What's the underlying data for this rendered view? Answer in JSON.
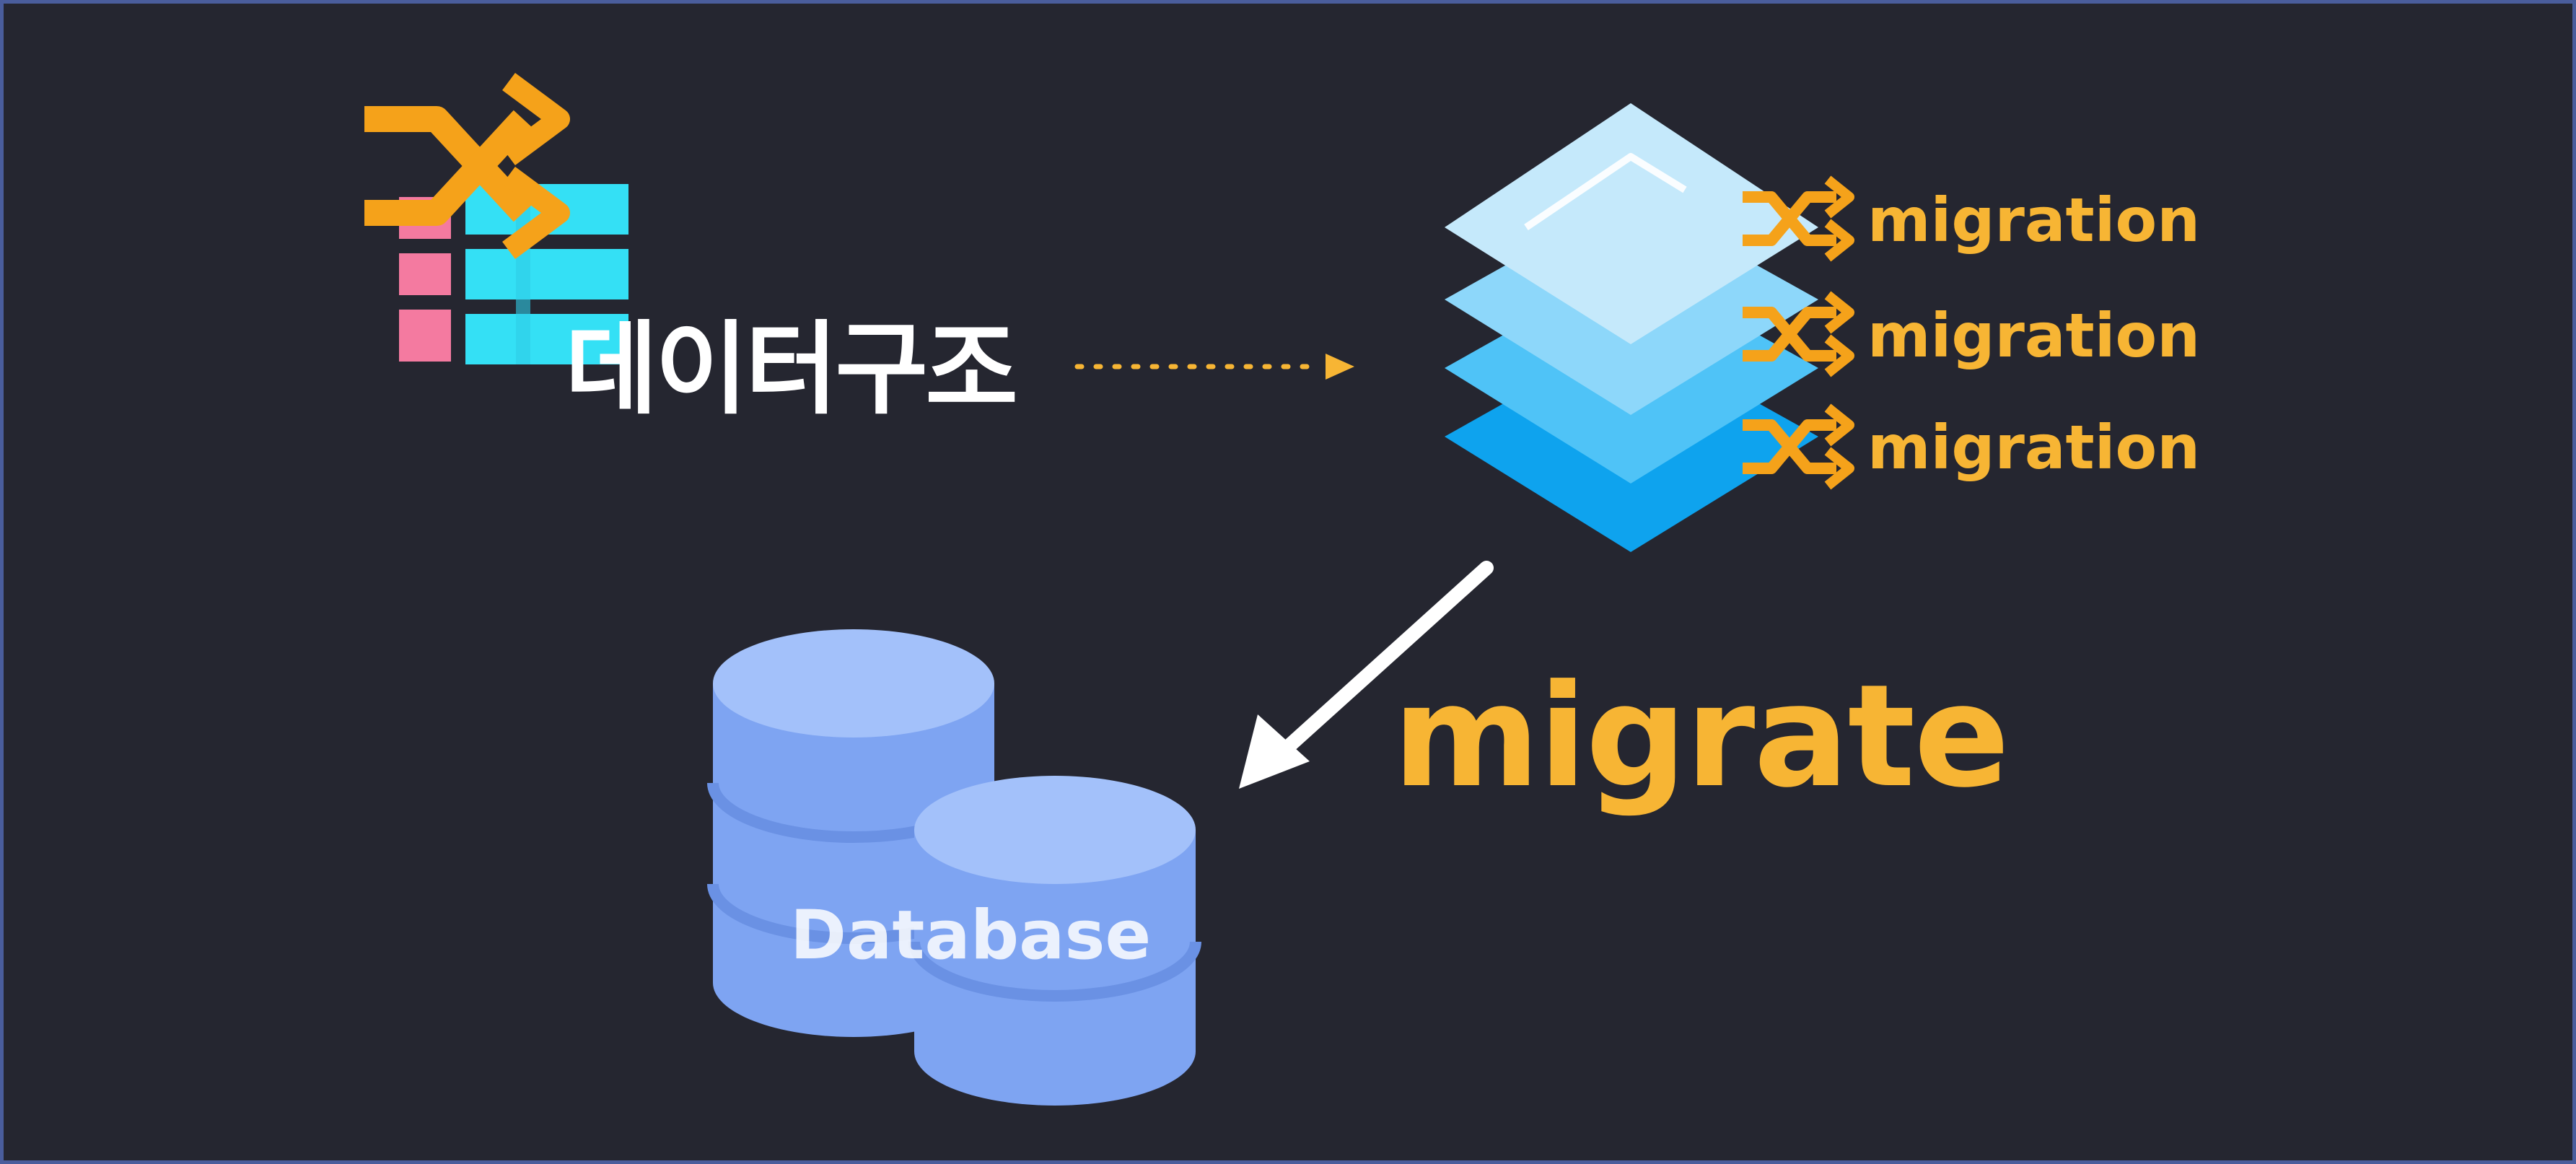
{
  "diagram": {
    "data_structure_label": "데이터구조",
    "migration_labels": [
      "migration",
      "migration",
      "migration"
    ],
    "migrate_label": "migrate",
    "database_label": "Database"
  },
  "colors": {
    "background": "#252630",
    "border": "#4a5d9c",
    "accent_orange": "#f7b534",
    "shuffle_icon": "#f5a21a",
    "table_cyan": "#34e0f5",
    "table_pink": "#f47aa0",
    "layer_light": "#c5e9fb",
    "layer_dark": "#0ea3ee",
    "database_blue": "#8bb0f6",
    "arrow_white": "#ffffff"
  },
  "icons": [
    "shuffle-icon",
    "table-icon",
    "layers-icon",
    "database-icon"
  ]
}
